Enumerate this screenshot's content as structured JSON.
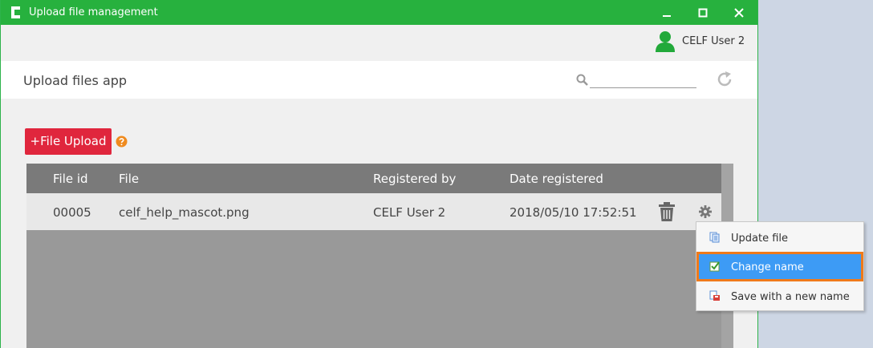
{
  "window": {
    "title": "Upload file management"
  },
  "user": {
    "name": "CELF User 2"
  },
  "header": {
    "app_title": "Upload files app",
    "search_placeholder": ""
  },
  "toolbar": {
    "upload_label": "+File Upload"
  },
  "table": {
    "columns": [
      "File id",
      "File",
      "Registered by",
      "Date registered"
    ],
    "rows": [
      {
        "file_id": "00005",
        "file": "celf_help_mascot.png",
        "registered_by": "CELF User 2",
        "date": "2018/05/10 17:52:51"
      }
    ]
  },
  "context_menu": {
    "items": [
      {
        "label": "Update file",
        "icon": "update-file-icon"
      },
      {
        "label": "Change name",
        "icon": "change-name-icon",
        "highlighted": true
      },
      {
        "label": "Save with a new name",
        "icon": "save-new-name-icon"
      }
    ]
  },
  "colors": {
    "titlebar": "#27b13e",
    "upload_button": "#e0263d",
    "menu_highlight": "#3d9bf5",
    "highlight_border": "#f07a1a"
  }
}
